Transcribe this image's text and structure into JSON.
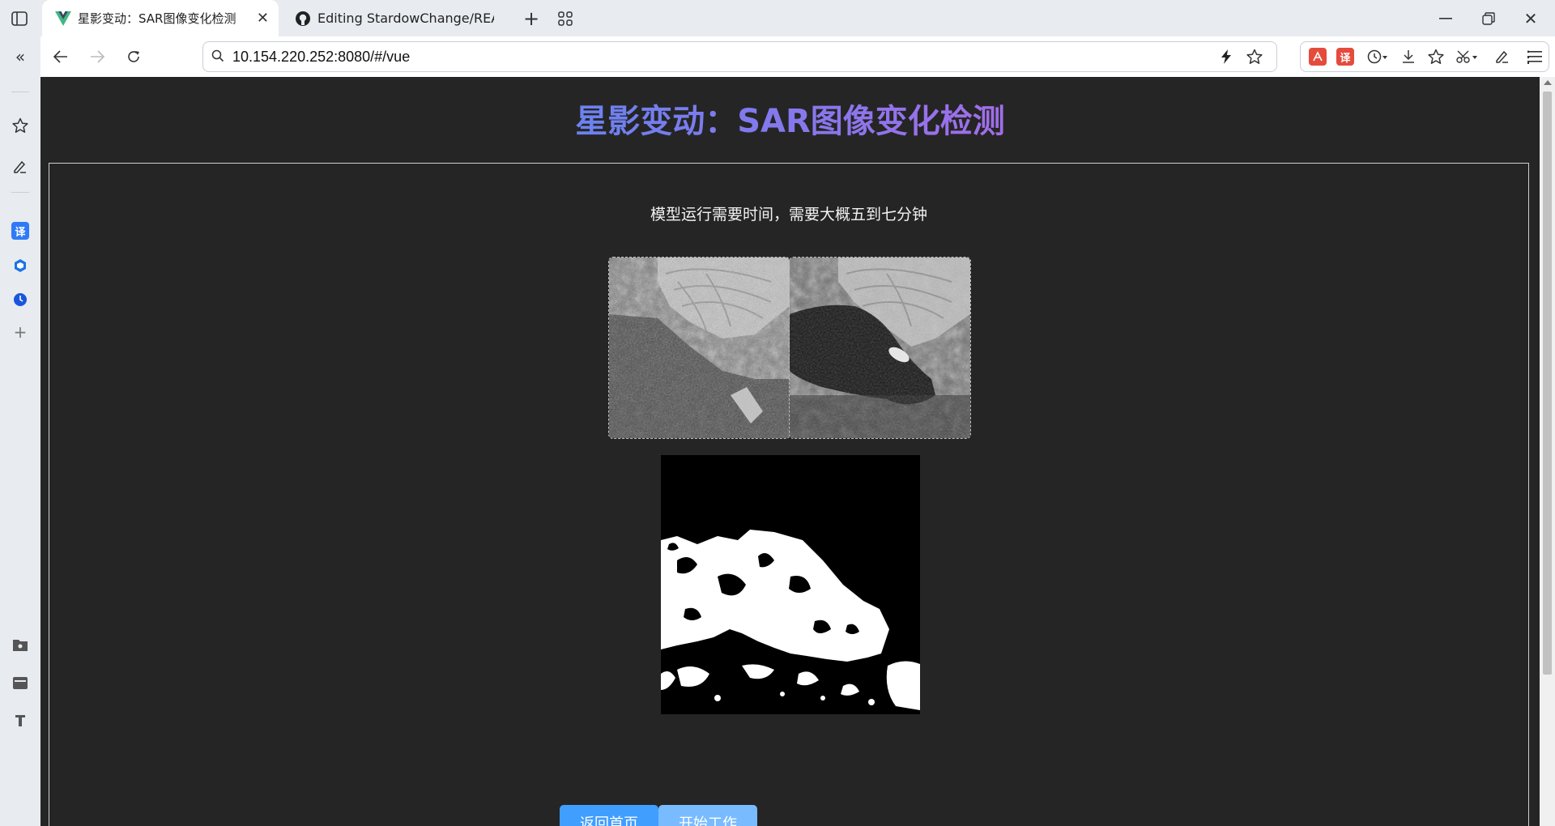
{
  "browser": {
    "tabs": [
      {
        "title": "星影变动：SAR图像变化检测",
        "icon": "vue-logo-icon",
        "active": true
      },
      {
        "title": "Editing StardowChange/READ",
        "icon": "github-icon",
        "active": false
      }
    ],
    "address": {
      "url": "10.154.220.252:8080/#/vue"
    },
    "accent": "#2f7bf6"
  },
  "page": {
    "title": "星影变动：SAR图像变化检测",
    "notice": "模型运行需要时间，需要大概五到七分钟",
    "images": {
      "before_alt": "SAR image before",
      "after_alt": "SAR image after",
      "result_alt": "Change detection result"
    },
    "buttons": {
      "back": "返回首页",
      "start": "开始工作"
    },
    "colors": {
      "background": "#252525",
      "title_gradient_start": "#6b82f0",
      "title_gradient_end": "#a06ee8",
      "back_button": "#409eff",
      "start_button": "#79bbff"
    }
  }
}
